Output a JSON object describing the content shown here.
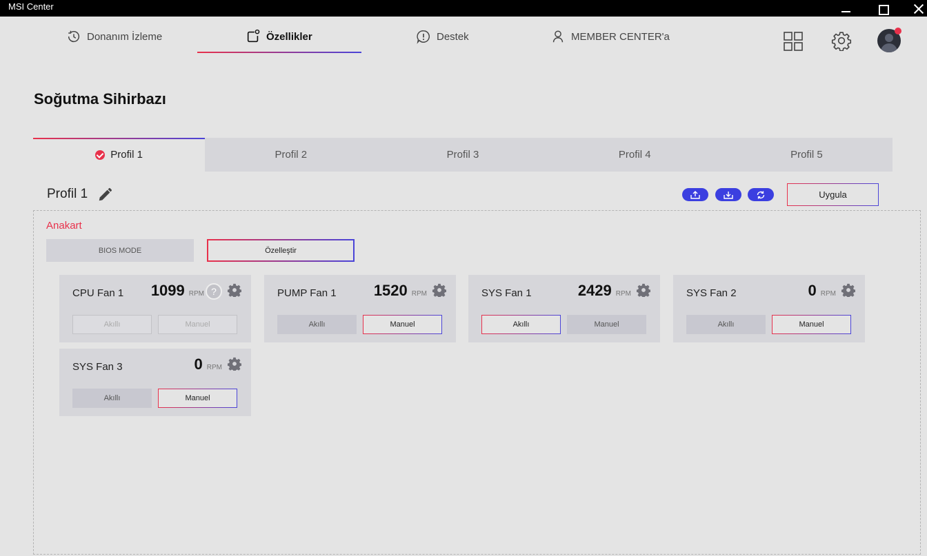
{
  "window": {
    "title": "MSI Center"
  },
  "nav": {
    "items": [
      {
        "label": "Donanım İzleme",
        "icon": "refresh-clock-icon"
      },
      {
        "label": "Özellikler",
        "icon": "features-icon",
        "active": true
      },
      {
        "label": "Destek",
        "icon": "support-icon"
      },
      {
        "label": "MEMBER CENTER'a",
        "icon": "user-icon"
      }
    ]
  },
  "page": {
    "title": "Soğutma Sihirbazı"
  },
  "profiles": {
    "tabs": [
      "Profil 1",
      "Profil 2",
      "Profil 3",
      "Profil 4",
      "Profil 5"
    ],
    "active_index": 0,
    "current_name": "Profil 1",
    "apply_label": "Uygula"
  },
  "section": {
    "label": "Anakart",
    "bios_mode_label": "BIOS MODE",
    "customize_label": "Özelleştir"
  },
  "fans": [
    {
      "name": "CPU Fan 1",
      "rpm": "1099",
      "unit": "RPM",
      "smart_label": "Akıllı",
      "manual_label": "Manuel",
      "mode": "disabled",
      "help": "?"
    },
    {
      "name": "PUMP Fan 1",
      "rpm": "1520",
      "unit": "RPM",
      "smart_label": "Akıllı",
      "manual_label": "Manuel",
      "mode": "manual"
    },
    {
      "name": "SYS Fan 1",
      "rpm": "2429",
      "unit": "RPM",
      "smart_label": "Akıllı",
      "manual_label": "Manuel",
      "mode": "smart"
    },
    {
      "name": "SYS Fan 2",
      "rpm": "0",
      "unit": "RPM",
      "smart_label": "Akıllı",
      "manual_label": "Manuel",
      "mode": "manual"
    },
    {
      "name": "SYS Fan 3",
      "rpm": "0",
      "unit": "RPM",
      "smart_label": "Akıllı",
      "manual_label": "Manuel",
      "mode": "manual"
    }
  ],
  "colors": {
    "accent_red": "#e8314b",
    "accent_blue": "#3b3fe0",
    "background": "#e4e4e4"
  }
}
